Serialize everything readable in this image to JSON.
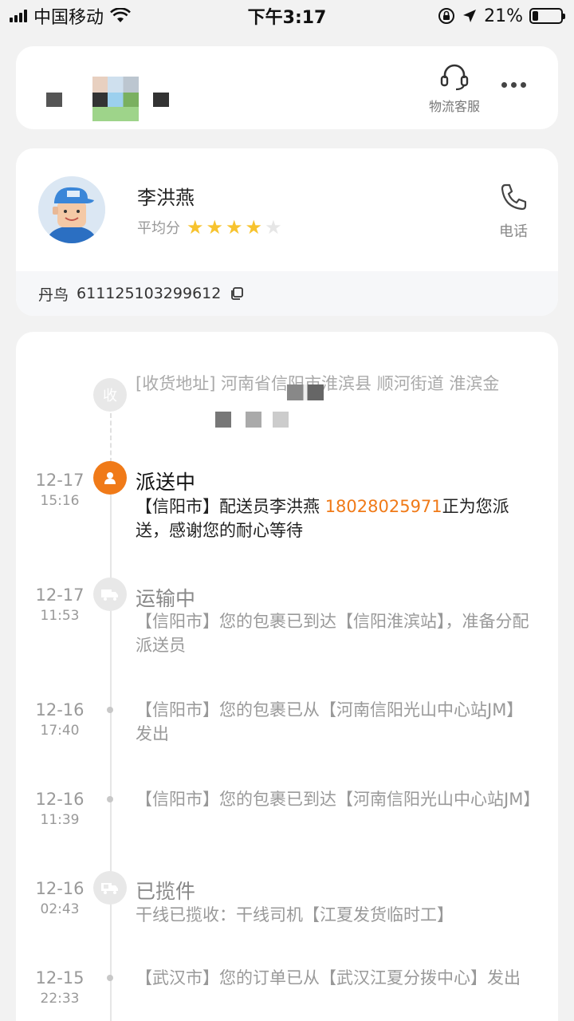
{
  "status_bar": {
    "carrier": "中国移动",
    "time": "下午3:17",
    "battery": "21%",
    "battery_level": 0.21
  },
  "header": {
    "service_label": "物流客服"
  },
  "courier": {
    "name": "李洪燕",
    "rating_label": "平均分",
    "rating": 4,
    "rating_max": 5,
    "phone_label": "电话",
    "company": "丹鸟",
    "tracking_number": "611125103299612"
  },
  "timeline": {
    "receiver": {
      "node_label": "收",
      "address": "[收货地址] 河南省信阳市淮滨县  顺河街道   淮滨金"
    },
    "entries": [
      {
        "date": "12-17",
        "time": "15:16",
        "status": "派送中",
        "text_before": "【信阳市】配送员李洪燕 ",
        "phone": "18028025971",
        "text_after": "正为您派送，感谢您的耐心等待",
        "icon": "courier-person-icon"
      },
      {
        "date": "12-17",
        "time": "11:53",
        "status": "运输中",
        "text": "【信阳市】您的包裹已到达【信阳淮滨站】，准备分配派送员",
        "icon": "truck-icon"
      },
      {
        "date": "12-16",
        "time": "17:40",
        "text": "【信阳市】您的包裹已从【河南信阳光山中心站JM】发出"
      },
      {
        "date": "12-16",
        "time": "11:39",
        "text": "【信阳市】您的包裹已到达【河南信阳光山中心站JM】"
      },
      {
        "date": "12-16",
        "time": "02:43",
        "status": "已揽件",
        "text": "干线已揽收：干线司机【江夏发货临时工】",
        "icon": "parcel-truck-icon"
      },
      {
        "date": "12-15",
        "time": "22:33",
        "text": "【武汉市】您的订单已从【武汉江夏分拨中心】发出"
      }
    ]
  },
  "colors": {
    "accent": "#f07a18",
    "star": "#f7c32e",
    "star_empty": "#e6e6e6"
  }
}
